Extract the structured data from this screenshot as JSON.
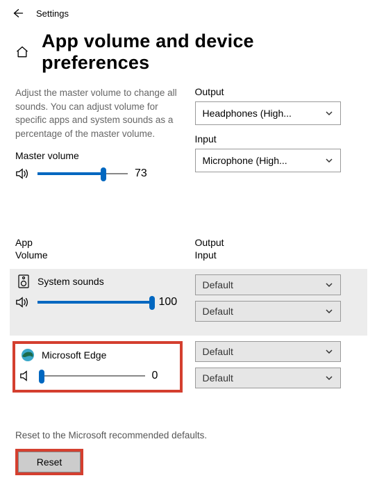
{
  "topbar": {
    "title": "Settings"
  },
  "page": {
    "title": "App volume and device preferences"
  },
  "description": "Adjust the master volume to change all sounds. You can adjust volume for specific apps and system sounds as a percentage of the master volume.",
  "master": {
    "label": "Master volume",
    "value": 73
  },
  "output": {
    "label": "Output",
    "value": "Headphones (High..."
  },
  "input": {
    "label": "Input",
    "value": "Microphone (High..."
  },
  "columns": {
    "app_line1": "App",
    "app_line2": "Volume",
    "dev_line1": "Output",
    "dev_line2": "Input"
  },
  "apps": [
    {
      "name": "System sounds",
      "volume": 100,
      "output": "Default",
      "input": "Default"
    },
    {
      "name": "Microsoft Edge",
      "volume": 0,
      "output": "Default",
      "input": "Default"
    }
  ],
  "reset": {
    "description": "Reset to the Microsoft recommended defaults.",
    "button": "Reset"
  }
}
